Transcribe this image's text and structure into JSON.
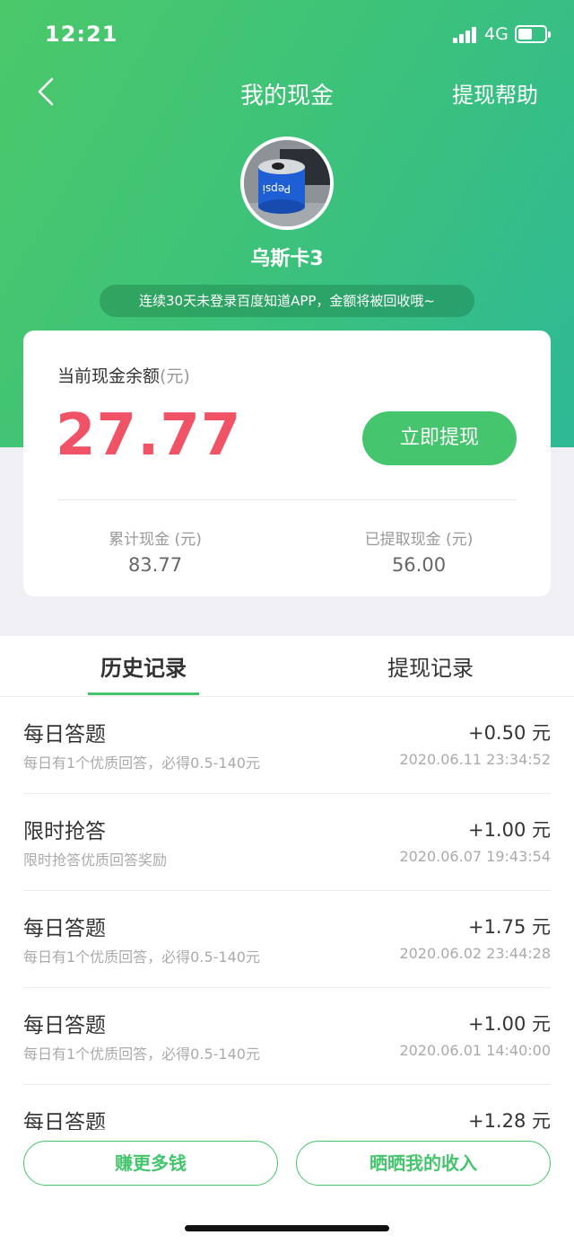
{
  "status": {
    "time": "12:21",
    "network": "4G"
  },
  "nav": {
    "title": "我的现金",
    "help": "提现帮助"
  },
  "profile": {
    "username": "乌斯卡3",
    "notice": "连续30天未登录百度知道APP，金额将被回收哦~"
  },
  "balance_card": {
    "label": "当前现金余额",
    "label_unit": "(元)",
    "amount": "27.77",
    "withdraw_button": "立即提现",
    "total_label": "累计现金 (元)",
    "total_value": "83.77",
    "withdrawn_label": "已提取现金 (元)",
    "withdrawn_value": "56.00"
  },
  "tabs": [
    {
      "label": "历史记录",
      "active": true
    },
    {
      "label": "提现记录",
      "active": false
    }
  ],
  "records": [
    {
      "title": "每日答题",
      "desc": "每日有1个优质回答，必得0.5-140元",
      "amount": "+0.50 元",
      "time": "2020.06.11 23:34:52"
    },
    {
      "title": "限时抢答",
      "desc": "限时抢答优质回答奖励",
      "amount": "+1.00 元",
      "time": "2020.06.07 19:43:54"
    },
    {
      "title": "每日答题",
      "desc": "每日有1个优质回答，必得0.5-140元",
      "amount": "+1.75 元",
      "time": "2020.06.02 23:44:28"
    },
    {
      "title": "每日答题",
      "desc": "每日有1个优质回答，必得0.5-140元",
      "amount": "+1.00 元",
      "time": "2020.06.01 14:40:00"
    },
    {
      "title": "每日答题",
      "desc": "",
      "amount": "+1.28 元",
      "time": ""
    }
  ],
  "bottom": {
    "earn_more": "赚更多钱",
    "share_income": "晒晒我的收入"
  },
  "colors": {
    "accent": "#45c56d",
    "balance": "#f05366"
  }
}
